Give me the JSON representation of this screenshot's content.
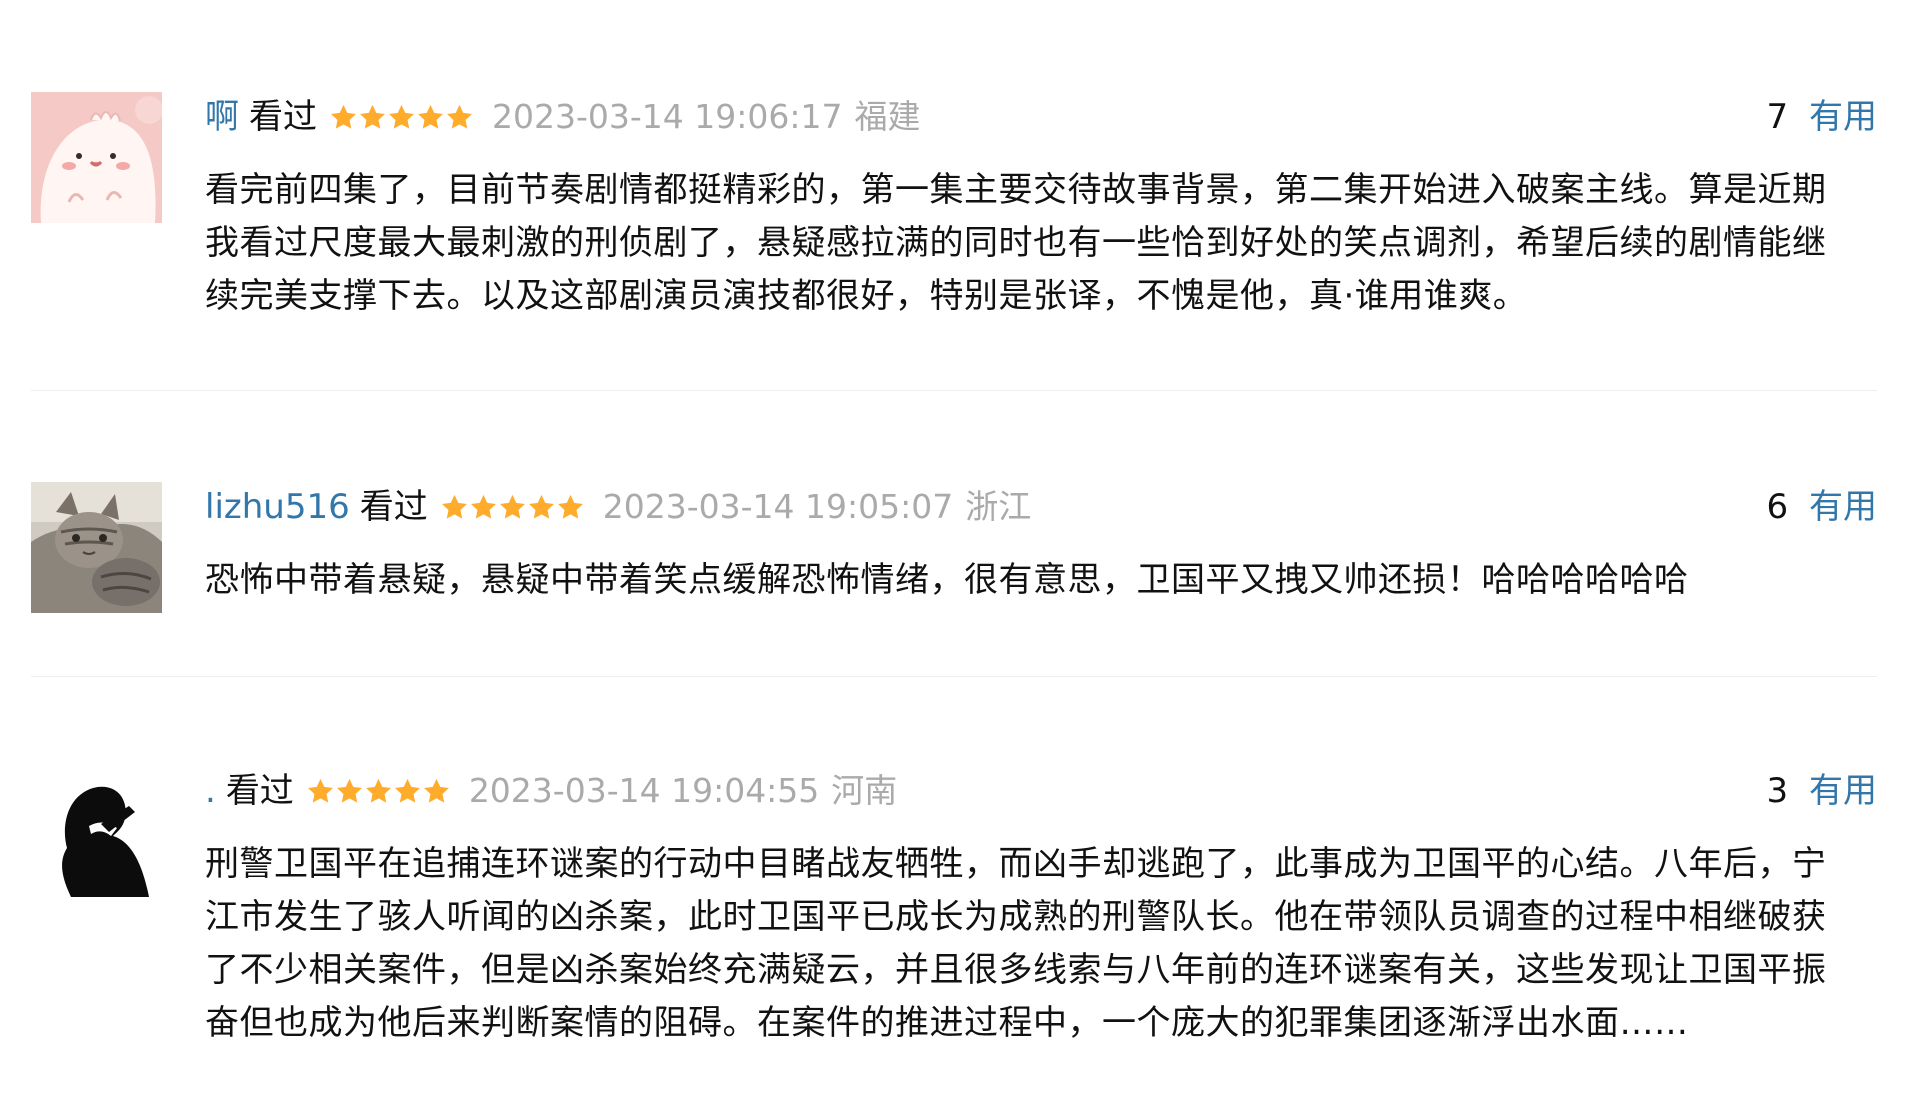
{
  "comments": [
    {
      "username": "啊",
      "watched_label": "看过",
      "rating_stars": 5,
      "timestamp": "2023-03-14 19:06:17",
      "location": "福建",
      "vote_count": "7",
      "vote_label": "有用",
      "avatar": "pink-cartoon-creature-avatar",
      "text": "看完前四集了，目前节奏剧情都挺精彩的，第一集主要交待故事背景，第二集开始进入破案主线。算是近期我看过尺度最大最刺激的刑侦剧了，悬疑感拉满的同时也有一些恰到好处的笑点调剂，希望后续的剧情能继续完美支撑下去。以及这部剧演员演技都很好，特别是张译，不愧是他，真·谁用谁爽。"
    },
    {
      "username": "lizhu516",
      "watched_label": "看过",
      "rating_stars": 5,
      "timestamp": "2023-03-14 19:05:07",
      "location": "浙江",
      "vote_count": "6",
      "vote_label": "有用",
      "avatar": "tabby-cat-photo-avatar",
      "text": "恐怖中带着悬疑，悬疑中带着笑点缓解恐怖情绪，很有意思，卫国平又拽又帅还损！哈哈哈哈哈哈"
    },
    {
      "username": ".",
      "watched_label": "看过",
      "rating_stars": 5,
      "timestamp": "2023-03-14 19:04:55",
      "location": "河南",
      "vote_count": "3",
      "vote_label": "有用",
      "avatar": "silhouette-person-avatar",
      "text": "刑警卫国平在追捕连环谜案的行动中目睹战友牺牲，而凶手却逃跑了，此事成为卫国平的心结。八年后，宁江市发生了骇人听闻的凶杀案，此时卫国平已成长为成熟的刑警队长。他在带领队员调查的过程中相继破获了不少相关案件，但是凶杀案始终充满疑云，并且很多线索与八年前的连环谜案有关，这些发现让卫国平振奋但也成为他后来判断案情的阻碍。在案件的推进过程中，一个庞大的犯罪集团逐渐浮出水面……"
    }
  ],
  "colors": {
    "link": "#3377aa",
    "star": "#ffac2d",
    "meta_gray": "#aaaaaa",
    "text": "#111111",
    "divider": "#eeeeee"
  }
}
